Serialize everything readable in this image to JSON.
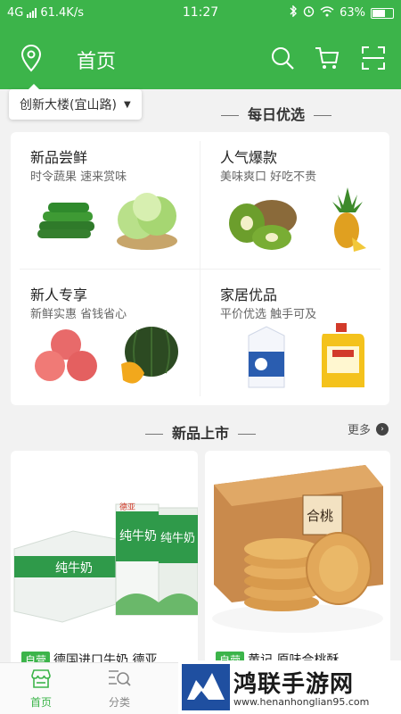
{
  "status_bar": {
    "network": "4G",
    "speed": "61.4K/s",
    "time": "11:27",
    "battery": "63%"
  },
  "header": {
    "title": "首页",
    "location_icon": "location-pin-icon",
    "search_icon": "search-icon",
    "cart_icon": "cart-icon",
    "scan_icon": "scan-icon"
  },
  "location_selector": {
    "label": "创新大楼(宜山路)"
  },
  "daily_section": {
    "title": "每日优选",
    "cells": [
      {
        "title": "新品尝鲜",
        "subtitle": "时令蔬果 速来赏味"
      },
      {
        "title": "人气爆款",
        "subtitle": "美味爽口 好吃不贵"
      },
      {
        "title": "新人专享",
        "subtitle": "新鲜实惠 省钱省心"
      },
      {
        "title": "家居优品",
        "subtitle": "平价优选 触手可及"
      }
    ]
  },
  "new_section": {
    "title": "新品上市",
    "more": "更多"
  },
  "products": [
    {
      "tag": "自营",
      "name": "德国进口牛奶 德亚",
      "pack_label": "纯牛奶",
      "brand": "德亚"
    },
    {
      "tag": "自营",
      "name": "黄记 原味合桃酥",
      "box_label": "合桃"
    }
  ],
  "tabbar": {
    "tabs": [
      {
        "label": "首页",
        "icon": "shop-icon"
      },
      {
        "label": "分类",
        "icon": "category-search-icon"
      }
    ]
  },
  "watermark": {
    "name": "鸿联手游网",
    "url": "www.henanhonglian95.com"
  },
  "colors": {
    "brand_green": "#3cb44a",
    "background": "#f2f2f2"
  }
}
